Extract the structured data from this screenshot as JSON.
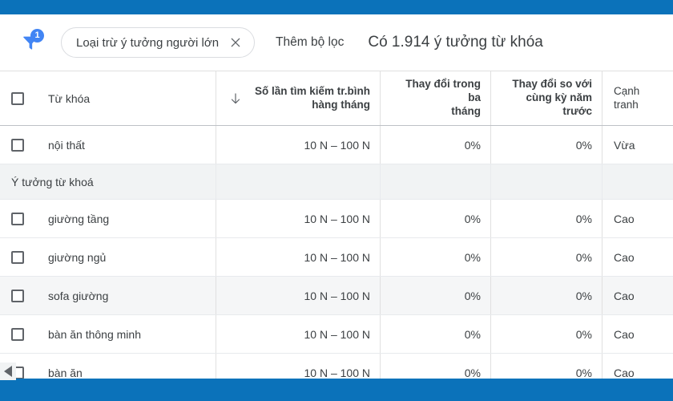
{
  "chrome": {
    "bar_color": "#0b72ba",
    "top_bar_name": "browser-top-bar",
    "bottom_bar_name": "browser-bottom-bar"
  },
  "toolbar": {
    "filter_icon": "filter-funnel-icon",
    "filter_badge_count": "1",
    "filter_chip_label": "Loại trừ ý tưởng người lớn",
    "chip_close_icon": "close-icon",
    "add_filter_label": "Thêm bộ lọc",
    "idea_count_label": "Có 1.914 ý tưởng từ khóa",
    "accent_color": "#4285f4"
  },
  "table": {
    "headers": {
      "keyword": "Từ khóa",
      "avg_monthly_searches_line1": "Số lần tìm kiếm tr.bình",
      "avg_monthly_searches_line2": "hàng tháng",
      "three_month_change_line1": "Thay đổi trong ba",
      "three_month_change_line2": "tháng",
      "yoy_change_line1": "Thay đổi so với",
      "yoy_change_line2": "cùng kỳ năm trước",
      "competition": "Cạnh tranh",
      "sort_icon": "sort-descending-arrow-icon"
    },
    "section_label": "Ý tưởng từ khoá",
    "seed_rows": [
      {
        "keyword": "nội thất",
        "avg_monthly_searches": "10 N – 100 N",
        "three_month_change": "0%",
        "yoy_change": "0%",
        "competition": "Vừa"
      }
    ],
    "idea_rows": [
      {
        "keyword": "giường tầng",
        "avg_monthly_searches": "10 N – 100 N",
        "three_month_change": "0%",
        "yoy_change": "0%",
        "competition": "Cao"
      },
      {
        "keyword": "giường ngủ",
        "avg_monthly_searches": "10 N – 100 N",
        "three_month_change": "0%",
        "yoy_change": "0%",
        "competition": "Cao"
      },
      {
        "keyword": "sofa giường",
        "avg_monthly_searches": "10 N – 100 N",
        "three_month_change": "0%",
        "yoy_change": "0%",
        "competition": "Cao"
      },
      {
        "keyword": "bàn ăn thông minh",
        "avg_monthly_searches": "10 N – 100 N",
        "three_month_change": "0%",
        "yoy_change": "0%",
        "competition": "Cao"
      },
      {
        "keyword": "bàn ăn",
        "avg_monthly_searches": "10 N – 100 N",
        "three_month_change": "0%",
        "yoy_change": "0%",
        "competition": "Cao"
      }
    ]
  },
  "overlay": {
    "scroll_left_icon": "scroll-left-arrow-icon"
  }
}
